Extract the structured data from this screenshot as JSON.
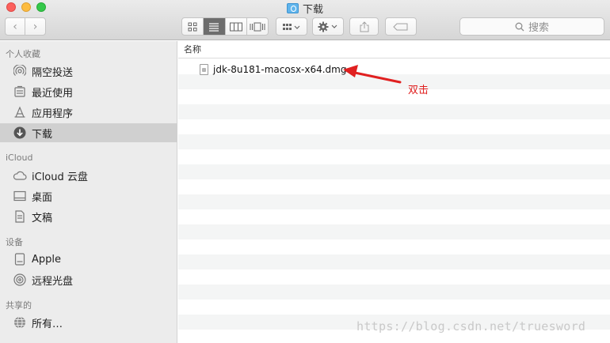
{
  "window": {
    "title": "下载"
  },
  "toolbar": {
    "back_glyph": "‹",
    "forward_glyph": "›",
    "views": [
      "icon-view",
      "list-view",
      "column-view",
      "coverflow-view"
    ],
    "active_view": "list-view",
    "search_placeholder": "搜索"
  },
  "sidebar": {
    "sections": [
      {
        "header": "个人收藏",
        "items": [
          {
            "label": "隔空投送",
            "icon": "airdrop-icon"
          },
          {
            "label": "最近使用",
            "icon": "recents-icon"
          },
          {
            "label": "应用程序",
            "icon": "applications-icon"
          },
          {
            "label": "下载",
            "icon": "downloads-icon",
            "selected": true
          }
        ]
      },
      {
        "header": "iCloud",
        "items": [
          {
            "label": "iCloud 云盘",
            "icon": "cloud-icon"
          },
          {
            "label": "桌面",
            "icon": "desktop-icon"
          },
          {
            "label": "文稿",
            "icon": "documents-icon"
          }
        ]
      },
      {
        "header": "设备",
        "items": [
          {
            "label": "Apple",
            "icon": "drive-icon"
          },
          {
            "label": "远程光盘",
            "icon": "disc-icon"
          }
        ]
      },
      {
        "header": "共享的",
        "items": [
          {
            "label": "所有…",
            "icon": "network-icon"
          }
        ]
      }
    ]
  },
  "filelist": {
    "column_name": "名称",
    "files": [
      {
        "name": "jdk-8u181-macosx-x64.dmg",
        "icon": "dmg-file-icon"
      }
    ]
  },
  "annotation": {
    "text": "双击",
    "color": "#e02020"
  },
  "watermark": "https://blog.csdn.net/truesword"
}
